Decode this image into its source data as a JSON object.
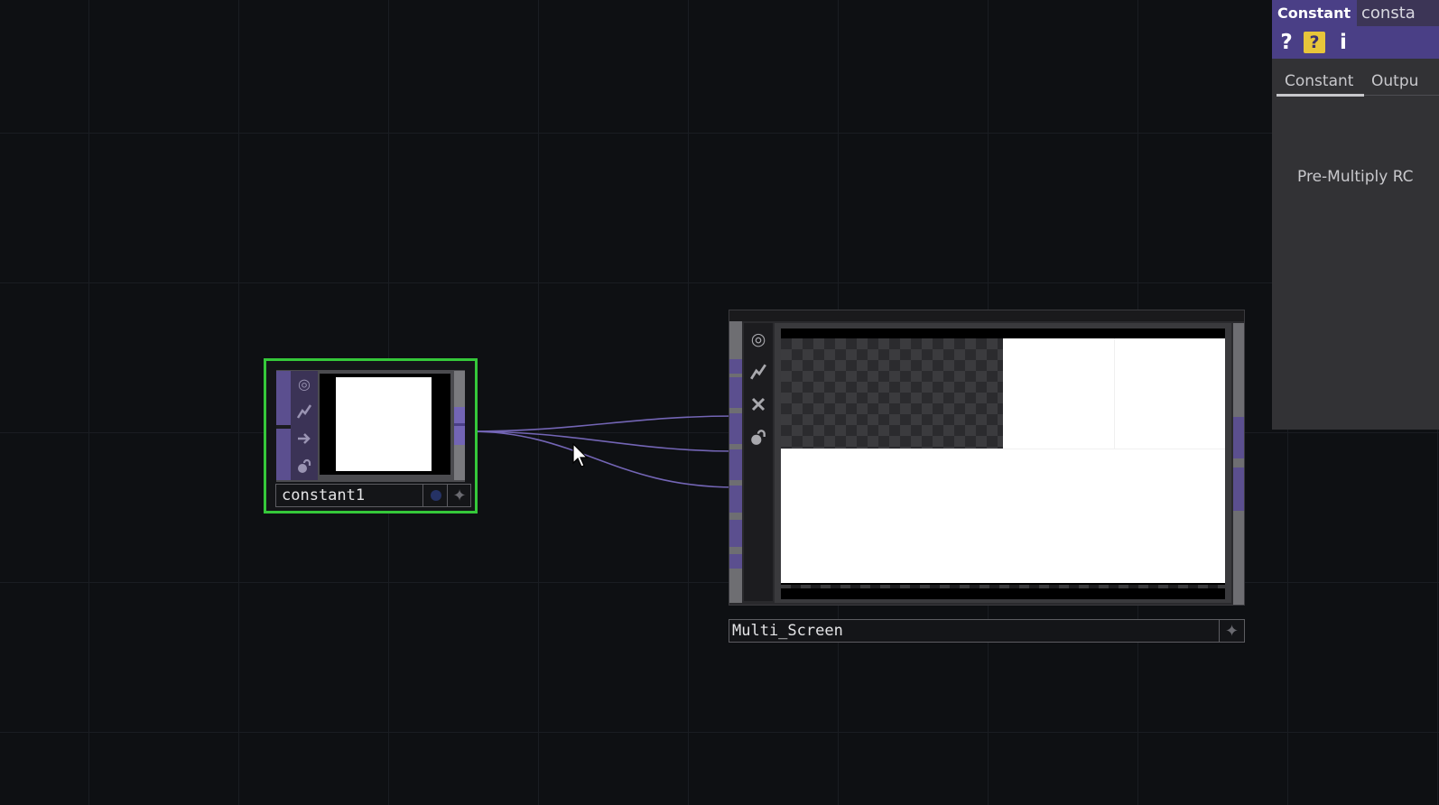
{
  "nodes": {
    "constant1": {
      "name": "constant1",
      "selected": true,
      "colors": {
        "selection_border": "#35c83a",
        "top_family": "#5b4f8f",
        "preview_fill": "#ffffff"
      }
    },
    "multi_screen": {
      "name": "Multi_Screen",
      "colors": {
        "port": "#5b4f8f",
        "viewer_fill": "#ffffff"
      }
    }
  },
  "wires": {
    "count": 3,
    "color": "#7365b5"
  },
  "parameter_panel": {
    "operator_type": "Constant",
    "operator_name": "consta",
    "toolbar": {
      "help_label": "?",
      "python_help_label": "?",
      "info_label": "i"
    },
    "tabs": [
      {
        "label": "Constant",
        "active": true
      },
      {
        "label": "Outpu",
        "active": false
      }
    ],
    "parameters": [
      {
        "label": "Pre-Multiply RC"
      }
    ]
  },
  "icons": {
    "viewer_toggle": "viewer-icon",
    "cook": "cook-icon",
    "bypass": "bypass-icon",
    "clone": "clone-icon",
    "lock": "lock-icon",
    "display_flag": "display-flag-icon",
    "add": "add-icon",
    "cursor": "mouse-cursor-icon"
  }
}
